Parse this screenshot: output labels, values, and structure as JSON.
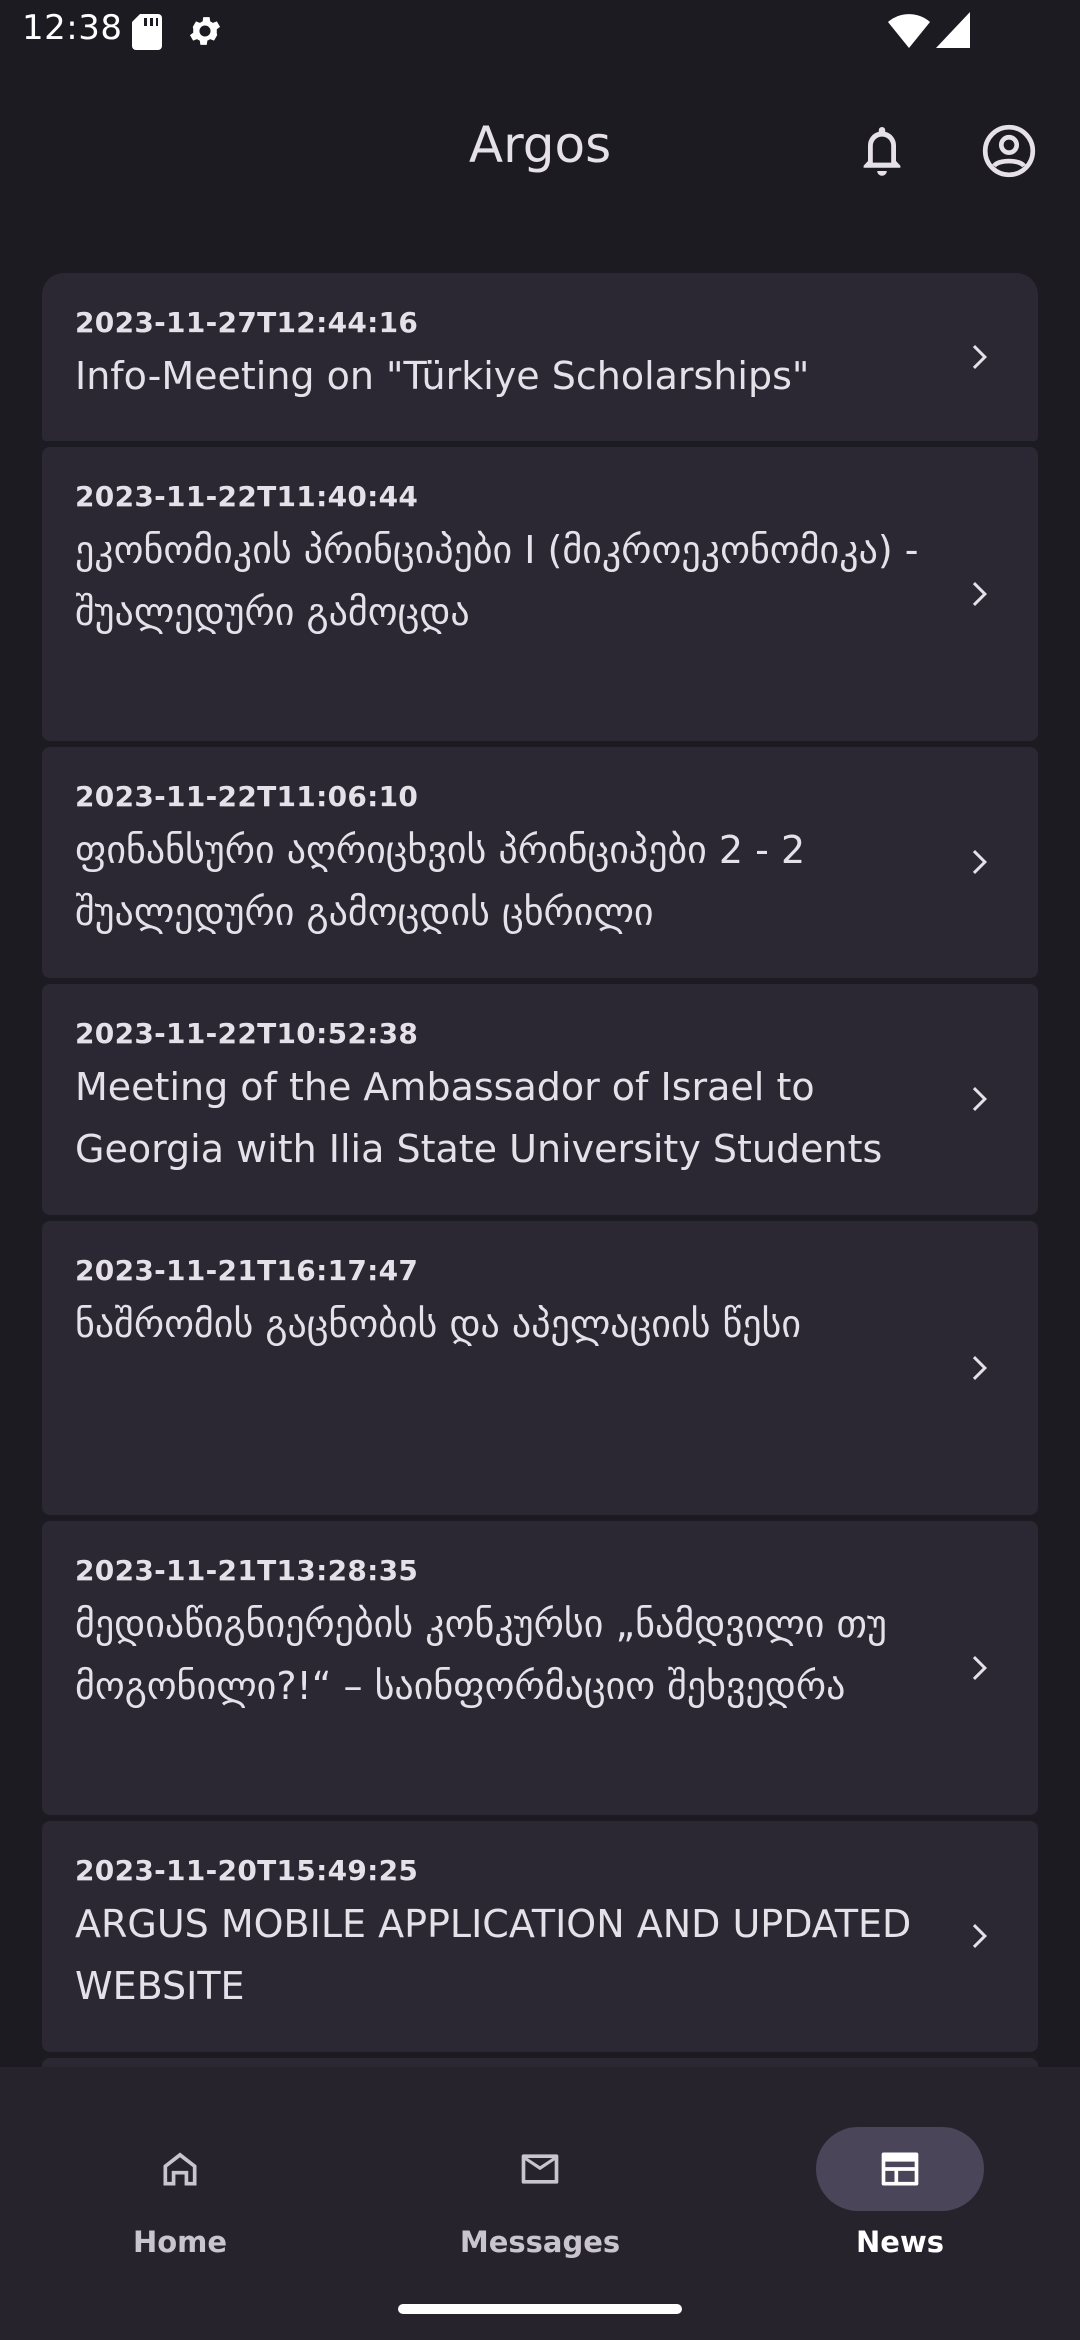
{
  "status_bar": {
    "time": "12:38",
    "icons": [
      "sd-card-icon",
      "settings-gear-icon",
      "wifi-icon",
      "cell-signal-icon"
    ]
  },
  "app_bar": {
    "title": "Argos",
    "actions": [
      "notifications-bell-icon",
      "account-circle-icon"
    ]
  },
  "news": {
    "items": [
      {
        "date": "2023-11-27T12:44:16",
        "title": "Info-Meeting on \"Türkiye Scholarships\""
      },
      {
        "date": "2023-11-22T11:40:44",
        "title": "ეკონომიკის პრინციპები I (მიკროეკონომიკა) - შუალედური გამოცდა"
      },
      {
        "date": "2023-11-22T11:06:10",
        "title": "ფინანსური აღრიცხვის პრინციპები 2  - 2 შუალედური გამოცდის ცხრილი"
      },
      {
        "date": "2023-11-22T10:52:38",
        "title": "Meeting of the Ambassador of Israel to Georgia with Ilia State University Students"
      },
      {
        "date": "2023-11-21T16:17:47",
        "title": "ნაშრომის გაცნობის და აპელაციის წესი"
      },
      {
        "date": "2023-11-21T13:28:35",
        "title": "მედიაწიგნიერების კონკურსი „ნამდვილი თუ მოგონილი?!“ – საინფორმაციო შეხვედრა"
      },
      {
        "date": "2023-11-20T15:49:25",
        "title": "ARGUS MOBILE APPLICATION AND UPDATED WEBSITE"
      }
    ]
  },
  "bottom_nav": {
    "items": [
      {
        "label": "Home",
        "icon": "home-icon",
        "active": false
      },
      {
        "label": "Messages",
        "icon": "mail-icon",
        "active": false
      },
      {
        "label": "News",
        "icon": "newspaper-icon",
        "active": true
      }
    ]
  },
  "colors": {
    "background": "#1c1b21",
    "card": "#2b2834",
    "nav_background": "#26232d",
    "active_pill": "#4a4558",
    "text": "#e6e1e9"
  }
}
